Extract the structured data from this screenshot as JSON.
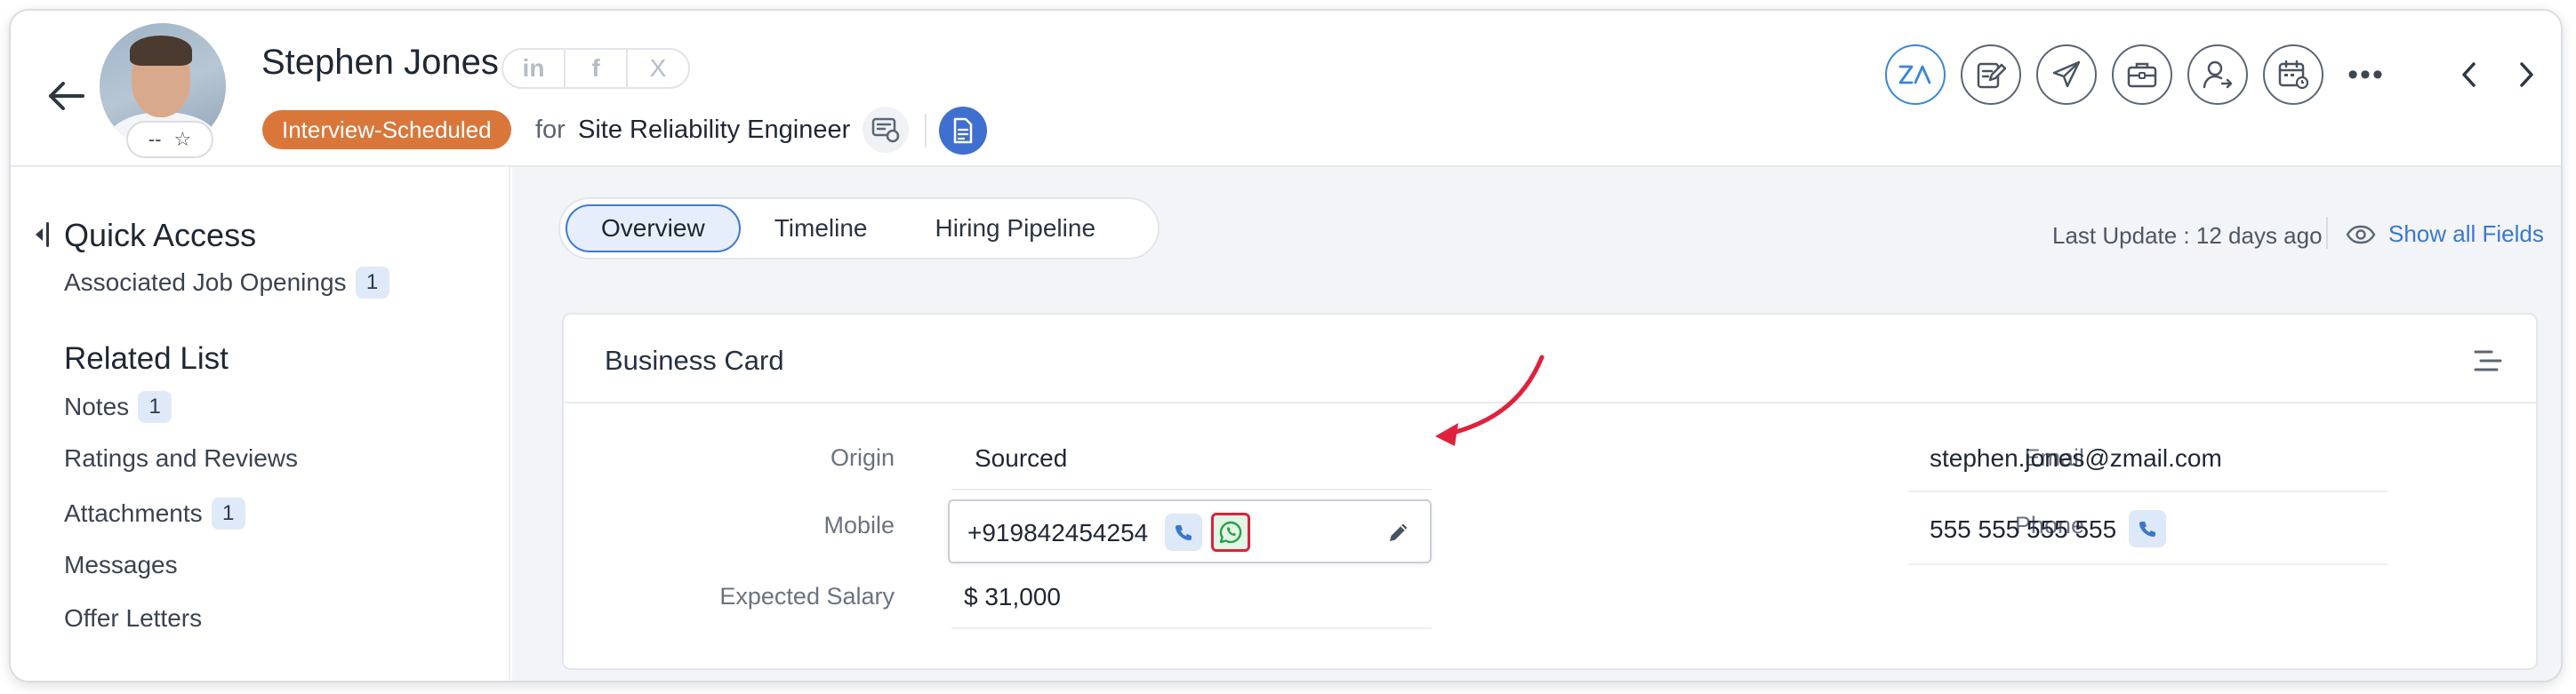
{
  "candidate": {
    "name": "Stephen Jones",
    "rating_text": "--",
    "status": "Interview-Scheduled",
    "for_text": "for",
    "job_title": "Site Reliability Engineer",
    "social": [
      "in",
      "f",
      "X"
    ]
  },
  "header_actions": [
    "zia-icon",
    "edit-note-icon",
    "send-icon",
    "briefcase-icon",
    "assign-user-icon",
    "calendar-icon"
  ],
  "sidebar": {
    "quick_access_title": "Quick Access",
    "quick_access_items": [
      {
        "label": "Associated Job Openings",
        "count": "1"
      }
    ],
    "related_list_title": "Related List",
    "related_items": [
      {
        "label": "Notes",
        "count": "1"
      },
      {
        "label": "Ratings and Reviews",
        "count": ""
      },
      {
        "label": "Attachments",
        "count": "1"
      },
      {
        "label": "Messages",
        "count": ""
      },
      {
        "label": "Offer Letters",
        "count": ""
      }
    ]
  },
  "tabs": [
    {
      "label": "Overview",
      "active": true
    },
    {
      "label": "Timeline",
      "active": false
    },
    {
      "label": "Hiring Pipeline",
      "active": false
    }
  ],
  "last_update": "Last Update : 12 days ago",
  "show_all_fields": "Show all Fields",
  "business_card": {
    "title": "Business Card",
    "origin_label": "Origin",
    "origin_value": "Sourced",
    "mobile_label": "Mobile",
    "mobile_value": "+919842454254",
    "salary_label": "Expected Salary",
    "salary_value": "$ 31,000",
    "email_label": "Email",
    "email_value": "stephen.jones@zmail.com",
    "phone_label": "Phone",
    "phone_value": "555 555 555 555"
  },
  "colors": {
    "accent_blue": "#3f7ad6",
    "status_orange": "#d9773a",
    "annotation_red": "#e0213d",
    "whatsapp_green": "#25a244"
  }
}
